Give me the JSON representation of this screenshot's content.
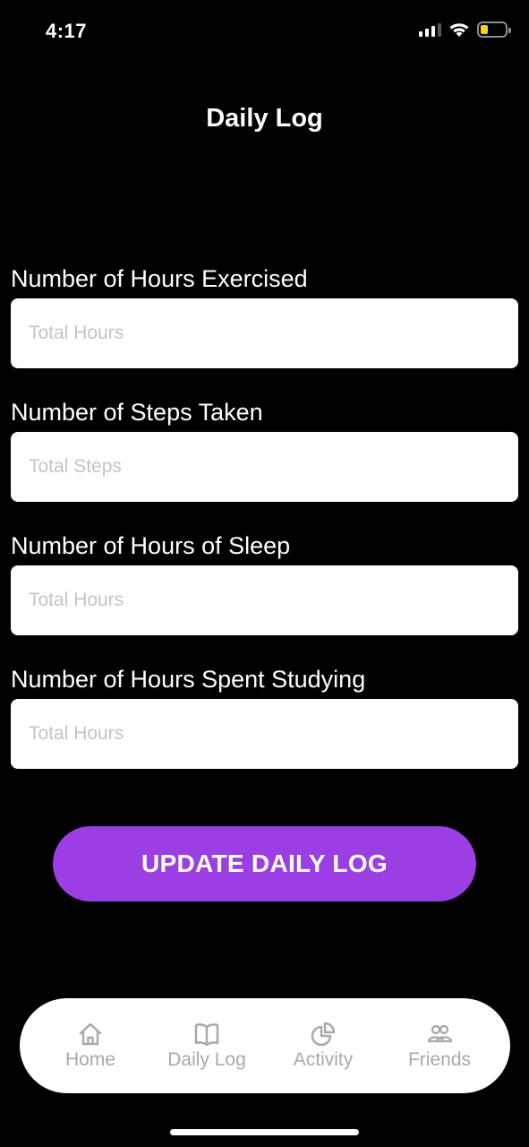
{
  "status_bar": {
    "time": "4:17"
  },
  "header": {
    "title": "Daily Log"
  },
  "form": {
    "fields": [
      {
        "label": "Number of Hours Exercised",
        "placeholder": "Total Hours",
        "value": ""
      },
      {
        "label": "Number of Steps Taken",
        "placeholder": "Total Steps",
        "value": ""
      },
      {
        "label": "Number of Hours of Sleep",
        "placeholder": "Total Hours",
        "value": ""
      },
      {
        "label": "Number of Hours Spent Studying",
        "placeholder": "Total Hours",
        "value": ""
      }
    ],
    "submit_label": "UPDATE DAILY LOG"
  },
  "tab_bar": {
    "items": [
      {
        "label": "Home",
        "icon": "home-icon"
      },
      {
        "label": "Daily Log",
        "icon": "book-icon"
      },
      {
        "label": "Activity",
        "icon": "pie-chart-icon"
      },
      {
        "label": "Friends",
        "icon": "people-icon"
      }
    ]
  },
  "colors": {
    "background": "#000000",
    "accent": "#9b3ee3",
    "tab_inactive": "#a9a9ad",
    "battery": "#f7d117"
  }
}
